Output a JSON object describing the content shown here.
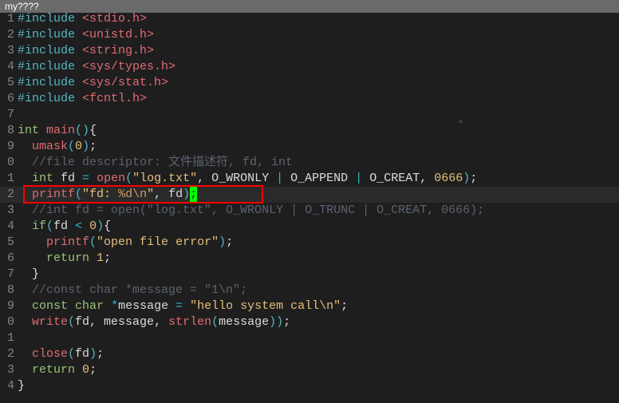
{
  "title": " my????",
  "visible_first_line": 1,
  "gutter": [
    "1",
    "2",
    "3",
    "4",
    "5",
    "6",
    "7",
    "8",
    "9",
    "0",
    "1",
    "2",
    "3",
    "4",
    "5",
    "6",
    "7",
    "8",
    "9",
    "0",
    "1",
    "2",
    "3",
    "4"
  ],
  "lines": [
    {
      "indent": 0,
      "tokens": [
        [
          "cyan",
          "#include"
        ],
        [
          "white",
          " "
        ],
        [
          "red",
          "<stdio.h>"
        ]
      ]
    },
    {
      "indent": 0,
      "tokens": [
        [
          "cyan",
          "#include"
        ],
        [
          "white",
          " "
        ],
        [
          "red",
          "<unistd.h>"
        ]
      ]
    },
    {
      "indent": 0,
      "tokens": [
        [
          "cyan",
          "#include"
        ],
        [
          "white",
          " "
        ],
        [
          "red",
          "<string.h>"
        ]
      ]
    },
    {
      "indent": 0,
      "tokens": [
        [
          "cyan",
          "#include"
        ],
        [
          "white",
          " "
        ],
        [
          "red",
          "<sys/types.h>"
        ]
      ]
    },
    {
      "indent": 0,
      "tokens": [
        [
          "cyan",
          "#include"
        ],
        [
          "white",
          " "
        ],
        [
          "red",
          "<sys/stat.h>"
        ]
      ]
    },
    {
      "indent": 0,
      "tokens": [
        [
          "cyan",
          "#include"
        ],
        [
          "white",
          " "
        ],
        [
          "red",
          "<fcntl.h>"
        ]
      ]
    },
    {
      "indent": 0,
      "tokens": []
    },
    {
      "indent": 0,
      "tokens": [
        [
          "green",
          "int"
        ],
        [
          "white",
          " "
        ],
        [
          "red",
          "main"
        ],
        [
          "cyan",
          "()"
        ],
        [
          "white",
          "{"
        ]
      ]
    },
    {
      "indent": 1,
      "tokens": [
        [
          "red",
          "umask"
        ],
        [
          "cyan",
          "("
        ],
        [
          "yellow",
          "0"
        ],
        [
          "cyan",
          ")"
        ],
        [
          "white",
          ";"
        ]
      ]
    },
    {
      "indent": 1,
      "tokens": [
        [
          "gray",
          "//file descriptor: 文件描述符, fd, int"
        ]
      ]
    },
    {
      "indent": 1,
      "tokens": [
        [
          "green",
          "int"
        ],
        [
          "white",
          " fd "
        ],
        [
          "teal",
          "="
        ],
        [
          "white",
          " "
        ],
        [
          "red",
          "open"
        ],
        [
          "cyan",
          "("
        ],
        [
          "yellow",
          "\"log.txt\""
        ],
        [
          "white",
          ", O_WRONLY "
        ],
        [
          "teal",
          "|"
        ],
        [
          "white",
          " O_APPEND "
        ],
        [
          "teal",
          "|"
        ],
        [
          "white",
          " O_CREAT, "
        ],
        [
          "yellow",
          "0666"
        ],
        [
          "cyan",
          ")"
        ],
        [
          "white",
          ";"
        ]
      ]
    },
    {
      "indent": 1,
      "tokens": [
        [
          "red",
          "printf"
        ],
        [
          "cyan",
          "("
        ],
        [
          "yellow",
          "\"fd: "
        ],
        [
          "orange",
          "%d\\n"
        ],
        [
          "yellow",
          "\""
        ],
        [
          "white",
          ", fd"
        ],
        [
          "cyan",
          ")"
        ]
      ],
      "cursorChar": ";"
    },
    {
      "indent": 1,
      "tokens": [
        [
          "gray",
          "//int fd = open(\"log.txt\", O_WRONLY | O_TRUNC | O_CREAT, 0666);"
        ]
      ]
    },
    {
      "indent": 1,
      "tokens": [
        [
          "green",
          "if"
        ],
        [
          "cyan",
          "("
        ],
        [
          "white",
          "fd "
        ],
        [
          "teal",
          "<"
        ],
        [
          "white",
          " "
        ],
        [
          "yellow",
          "0"
        ],
        [
          "cyan",
          ")"
        ],
        [
          "white",
          "{"
        ]
      ]
    },
    {
      "indent": 2,
      "tokens": [
        [
          "red",
          "printf"
        ],
        [
          "cyan",
          "("
        ],
        [
          "yellow",
          "\"open file error\""
        ],
        [
          "cyan",
          ")"
        ],
        [
          "white",
          ";"
        ]
      ]
    },
    {
      "indent": 2,
      "tokens": [
        [
          "green",
          "return"
        ],
        [
          "white",
          " "
        ],
        [
          "yellow",
          "1"
        ],
        [
          "white",
          ";"
        ]
      ]
    },
    {
      "indent": 1,
      "tokens": [
        [
          "white",
          "}"
        ]
      ]
    },
    {
      "indent": 1,
      "tokens": [
        [
          "gray",
          "//const char *message = \"1\\n\";"
        ]
      ]
    },
    {
      "indent": 1,
      "tokens": [
        [
          "green",
          "const"
        ],
        [
          "white",
          " "
        ],
        [
          "green",
          "char"
        ],
        [
          "white",
          " "
        ],
        [
          "teal",
          "*"
        ],
        [
          "white",
          "message "
        ],
        [
          "teal",
          "="
        ],
        [
          "white",
          " "
        ],
        [
          "yellow",
          "\"hello system call\\n\""
        ],
        [
          "white",
          ";"
        ]
      ]
    },
    {
      "indent": 1,
      "tokens": [
        [
          "red",
          "write"
        ],
        [
          "cyan",
          "("
        ],
        [
          "white",
          "fd, message, "
        ],
        [
          "red",
          "strlen"
        ],
        [
          "cyan",
          "("
        ],
        [
          "white",
          "message"
        ],
        [
          "cyan",
          "))"
        ],
        [
          "white",
          ";"
        ]
      ]
    },
    {
      "indent": 0,
      "tokens": []
    },
    {
      "indent": 1,
      "tokens": [
        [
          "red",
          "close"
        ],
        [
          "cyan",
          "("
        ],
        [
          "white",
          "fd"
        ],
        [
          "cyan",
          ")"
        ],
        [
          "white",
          ";"
        ]
      ]
    },
    {
      "indent": 1,
      "tokens": [
        [
          "green",
          "return"
        ],
        [
          "white",
          " "
        ],
        [
          "yellow",
          "0"
        ],
        [
          "white",
          ";"
        ]
      ]
    },
    {
      "indent": 0,
      "tokens": [
        [
          "white",
          "}"
        ]
      ]
    }
  ],
  "highlight_line_index": 11,
  "indent_unit": "  ",
  "chart_data": null
}
